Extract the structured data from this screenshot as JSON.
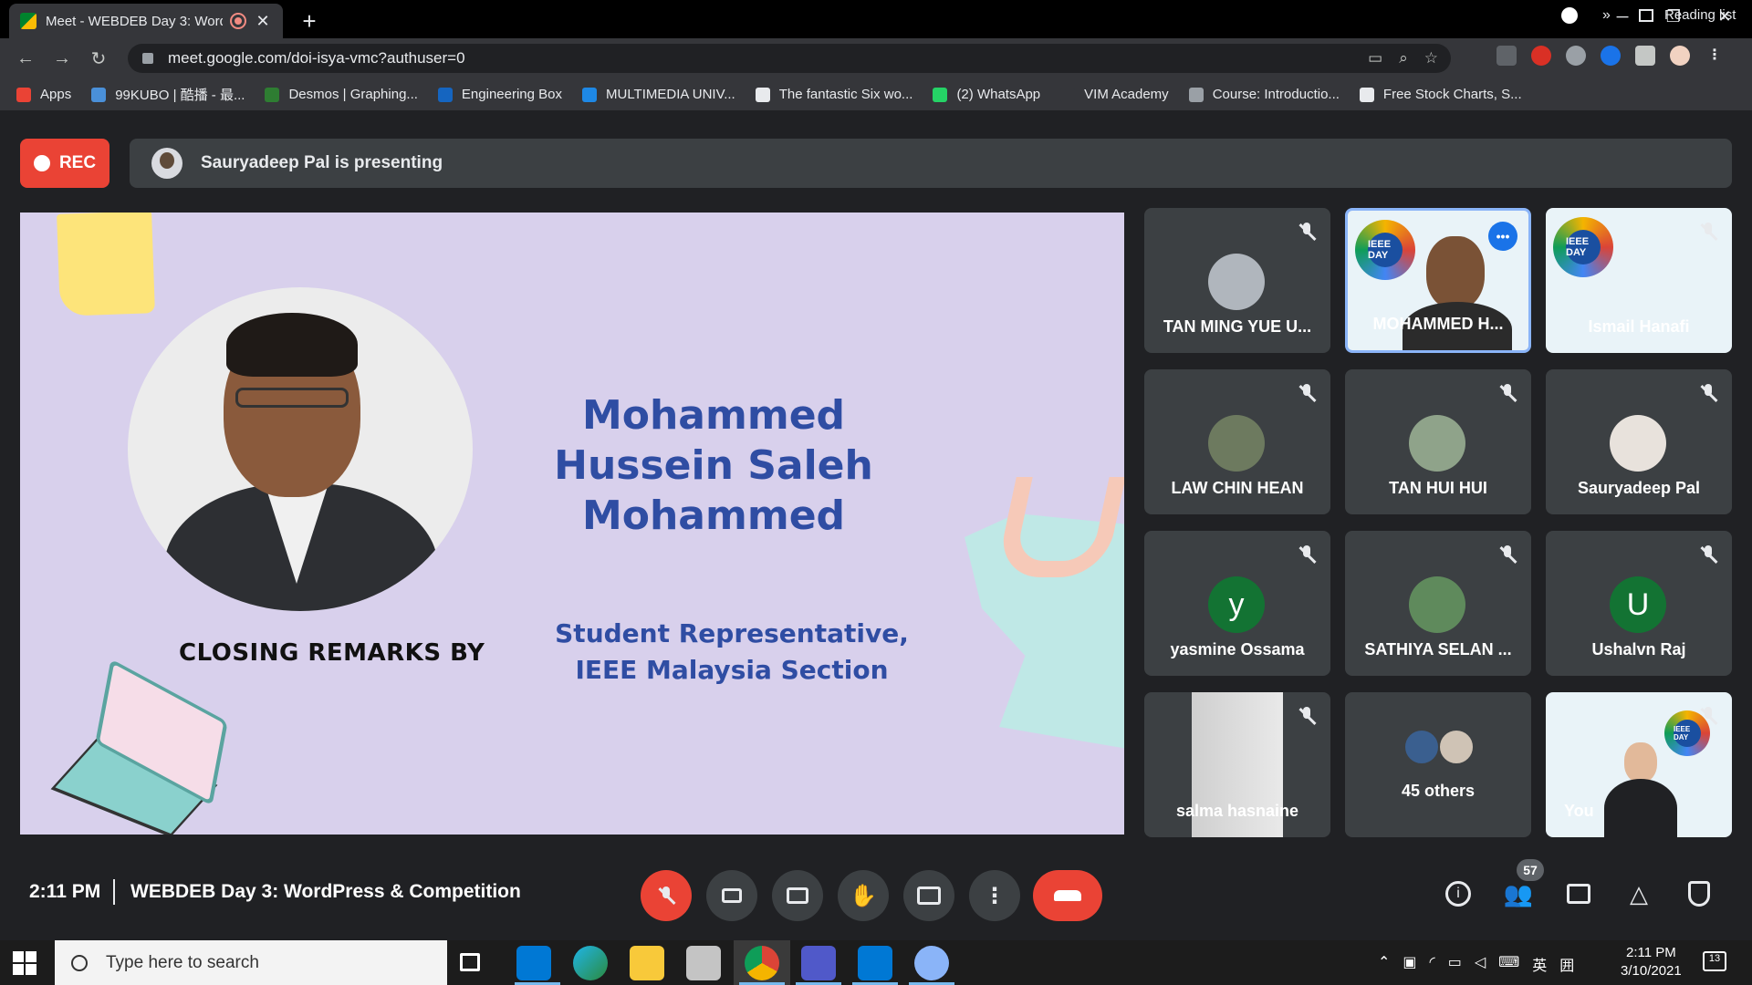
{
  "browser": {
    "tab_title": "Meet - WEBDEB Day 3: Word",
    "tab_close": "✕",
    "new_tab": "+",
    "url": "meet.google.com/doi-isya-vmc?authuser=0",
    "window_controls": [
      "─",
      "❐",
      "✕"
    ],
    "nav": [
      "←",
      "→",
      "↻"
    ],
    "omni_icons": [
      "▭",
      "⌕",
      "☆"
    ]
  },
  "bookmarks": [
    {
      "label": "Apps",
      "color": "#ea4335"
    },
    {
      "label": "99KUBO | 酷播 - 最...",
      "color": "#4a90d9"
    },
    {
      "label": "Desmos | Graphing...",
      "color": "#2e7d32"
    },
    {
      "label": "Engineering Box",
      "color": "#1565c0"
    },
    {
      "label": "MULTIMEDIA UNIV...",
      "color": "#1e88e5"
    },
    {
      "label": "The fantastic Six wo...",
      "color": "#e8eaed"
    },
    {
      "label": "(2) WhatsApp",
      "color": "#25d366"
    },
    {
      "label": "VIM Academy",
      "color": "#35363a"
    },
    {
      "label": "Course: Introductio...",
      "color": "#9aa0a6"
    },
    {
      "label": "Free Stock Charts, S...",
      "color": "#e8eaed"
    }
  ],
  "bookmarks_more": "»",
  "reading_list": "Reading list",
  "meet": {
    "rec_label": "REC",
    "presenting_text": "Sauryadeep Pal is presenting",
    "slide": {
      "speaker_name": [
        "Mohammed",
        "Hussein Saleh",
        "Mohammed"
      ],
      "role": [
        "Student Representative,",
        "IEEE Malaysia Section"
      ],
      "closing": "CLOSING REMARKS BY"
    },
    "tiles": [
      {
        "name": "TAN MING YUE U...",
        "muted": true
      },
      {
        "name": "MOHAMMED H...",
        "muted": false,
        "speaking": true
      },
      {
        "name": "Ismail Hanafi",
        "muted": true
      },
      {
        "name": "LAW CHIN HEAN",
        "muted": true
      },
      {
        "name": "TAN HUI HUI",
        "muted": true
      },
      {
        "name": "Sauryadeep Pal",
        "muted": true
      },
      {
        "name": "yasmine Ossama",
        "muted": true,
        "letter": "y",
        "color": "#137333"
      },
      {
        "name": "SATHIYA SELAN ...",
        "muted": true
      },
      {
        "name": "Ushalvn Raj",
        "muted": true,
        "letter": "U",
        "color": "#137333"
      },
      {
        "name": "salma hasnaine",
        "muted": true
      },
      {
        "name": "45 others"
      },
      {
        "name": "You",
        "muted": true
      }
    ],
    "ieee_logo_text": "IEEE DAY",
    "time": "2:11 PM",
    "meeting_title": "WEBDEB Day 3: WordPress & Competition",
    "participant_count": "57"
  },
  "taskbar": {
    "search_placeholder": "Type here to search",
    "tray_lang": "英",
    "tray_time": "2:11 PM",
    "tray_date": "3/10/2021",
    "notification_count": "13"
  }
}
